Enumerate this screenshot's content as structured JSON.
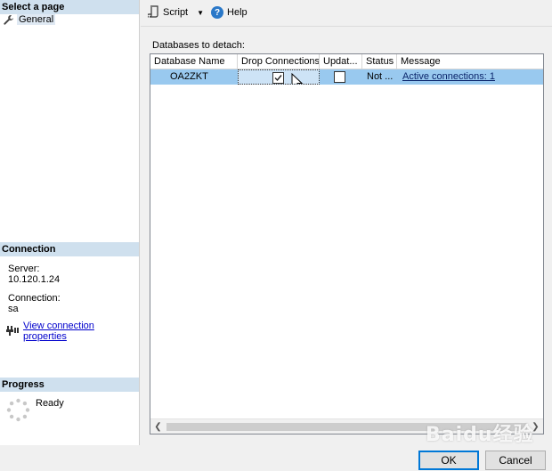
{
  "left": {
    "select_page_header": "Select a page",
    "pages": [
      {
        "label": "General",
        "icon": "wrench-icon"
      }
    ],
    "connection_header": "Connection",
    "server_label": "Server:",
    "server_value": "10.120.1.24",
    "connection_label": "Connection:",
    "connection_value": "sa",
    "view_connection_link": "View connection properties",
    "progress_header": "Progress",
    "progress_status": "Ready"
  },
  "toolbar": {
    "script_label": "Script",
    "help_label": "Help"
  },
  "grid": {
    "caption": "Databases to detach:",
    "columns": [
      "Database Name",
      "Drop Connections",
      "Updat...",
      "Status",
      "Message"
    ],
    "rows": [
      {
        "database_name": "OA2ZKT",
        "drop_connections": true,
        "update_statistics": false,
        "status": "Not ...",
        "message": "Active connections: 1"
      }
    ]
  },
  "buttons": {
    "ok_label": "OK",
    "cancel_label": "Cancel"
  },
  "watermark_text": "Baidu经验",
  "colors": {
    "section_header_bg": "#cfe0ee",
    "selected_row_bg": "#99c9ef",
    "ok_border": "#0078d7",
    "link": "#0000cc"
  }
}
